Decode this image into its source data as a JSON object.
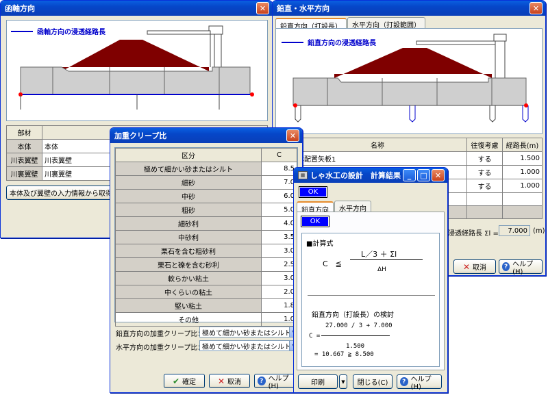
{
  "win_left": {
    "title": "函軸方向",
    "legend": "函軸方向の浸透経路長",
    "table_header": "部材",
    "rows": [
      {
        "label": "本体",
        "value": "本体"
      },
      {
        "label": "川表翼壁",
        "value": "川表翼壁"
      },
      {
        "label": "川裏翼壁",
        "value": "川裏翼壁"
      }
    ],
    "fetch_button": "本体及び翼壁の入力情報から取得"
  },
  "win_right": {
    "title": "鉛直・水平方向",
    "tabs": [
      "鉛直方向（打設長）",
      "水平方向（打設範囲）"
    ],
    "legend": "鉛直方向の浸透経路長",
    "table_headers": [
      "",
      "名称",
      "往復考慮",
      "経路長(m)"
    ],
    "rows": [
      {
        "name": "本体配置矢板1",
        "round": "する",
        "length": "1.500"
      },
      {
        "name": "",
        "round": "する",
        "length": "1.000"
      },
      {
        "name": "",
        "round": "する",
        "length": "1.000"
      }
    ],
    "sum_label": "浸透経路長 Σl =",
    "sum_value": "7.000",
    "sum_unit": "(m)",
    "cancel": "取消",
    "help": "ヘルプ(H)"
  },
  "win_creep": {
    "title": "加重クリープ比",
    "headers": [
      "区分",
      "C"
    ],
    "rows": [
      {
        "name": "極めて細かい砂またはシルト",
        "c": "8.5"
      },
      {
        "name": "細砂",
        "c": "7.0"
      },
      {
        "name": "中砂",
        "c": "6.0"
      },
      {
        "name": "粗砂",
        "c": "5.0"
      },
      {
        "name": "細砂利",
        "c": "4.0"
      },
      {
        "name": "中砂利",
        "c": "3.5"
      },
      {
        "name": "栗石を含む粗砂利",
        "c": "3.0"
      },
      {
        "name": "栗石と礫を含む砂利",
        "c": "2.5"
      },
      {
        "name": "軟らかい粘土",
        "c": "3.0"
      },
      {
        "name": "中くらいの粘土",
        "c": "2.0"
      },
      {
        "name": "堅い粘土",
        "c": "1.8"
      },
      {
        "name": "その他",
        "c": "1.0"
      }
    ],
    "vertical_label": "鉛直方向の加重クリープ比：",
    "vertical_value": "極めて細かい砂またはシルト",
    "horizontal_label": "水平方向の加重クリープ比：",
    "horizontal_value": "極めて細かい砂またはシルト",
    "confirm": "確定",
    "cancel": "取消",
    "help": "ヘルプ(H)"
  },
  "win_result": {
    "title": "しゃ水工の設計　計算結果",
    "ok": "OK",
    "tabs": [
      "鉛直方向",
      "水平方向"
    ],
    "ok2": "OK",
    "formula_title": "■計算式",
    "formula_c": "C　≦",
    "formula_num": "L／3 ＋ Σl",
    "formula_den": "ΔH",
    "check_title": "鉛直方向（打設長）の検討",
    "calc_num": "27.000 / 3 + 7.000",
    "calc_c": "C =",
    "calc_den": "1.500",
    "calc_result": "= 10.667 ≧ 8.500",
    "print": "印刷",
    "close": "閉じる(C)",
    "help": "ヘルプ(H)"
  }
}
